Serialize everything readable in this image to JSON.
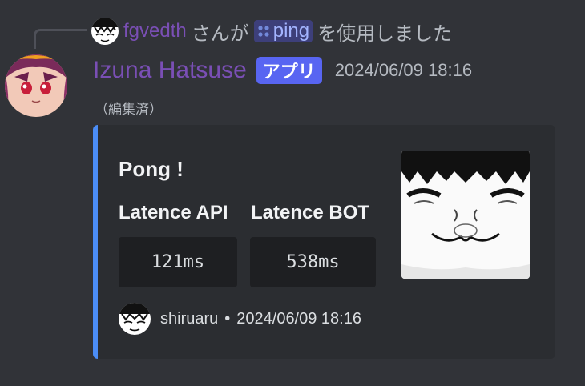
{
  "reply": {
    "user": "fgvedth",
    "text_before": "さんが",
    "command_icon": "slash-command-icon",
    "command_name": "ping",
    "text_after": "を使用しました"
  },
  "message": {
    "author": "Izuna Hatsuse",
    "app_badge": "アプリ",
    "timestamp": "2024/06/09 18:16",
    "edited_label": "（編集済）"
  },
  "embed": {
    "accent_color": "#4b8df6",
    "title": "Pong !",
    "fields": [
      {
        "name": "Latence API",
        "value": "121ms"
      },
      {
        "name": "Latence BOT",
        "value": "538ms"
      }
    ],
    "footer": {
      "author": "shiruaru",
      "separator": "•",
      "timestamp": "2024/06/09 18:16"
    }
  },
  "colors": {
    "background": "#313338",
    "embed_background": "#2b2d31",
    "username": "#7a4fb5",
    "badge": "#5865f2"
  }
}
